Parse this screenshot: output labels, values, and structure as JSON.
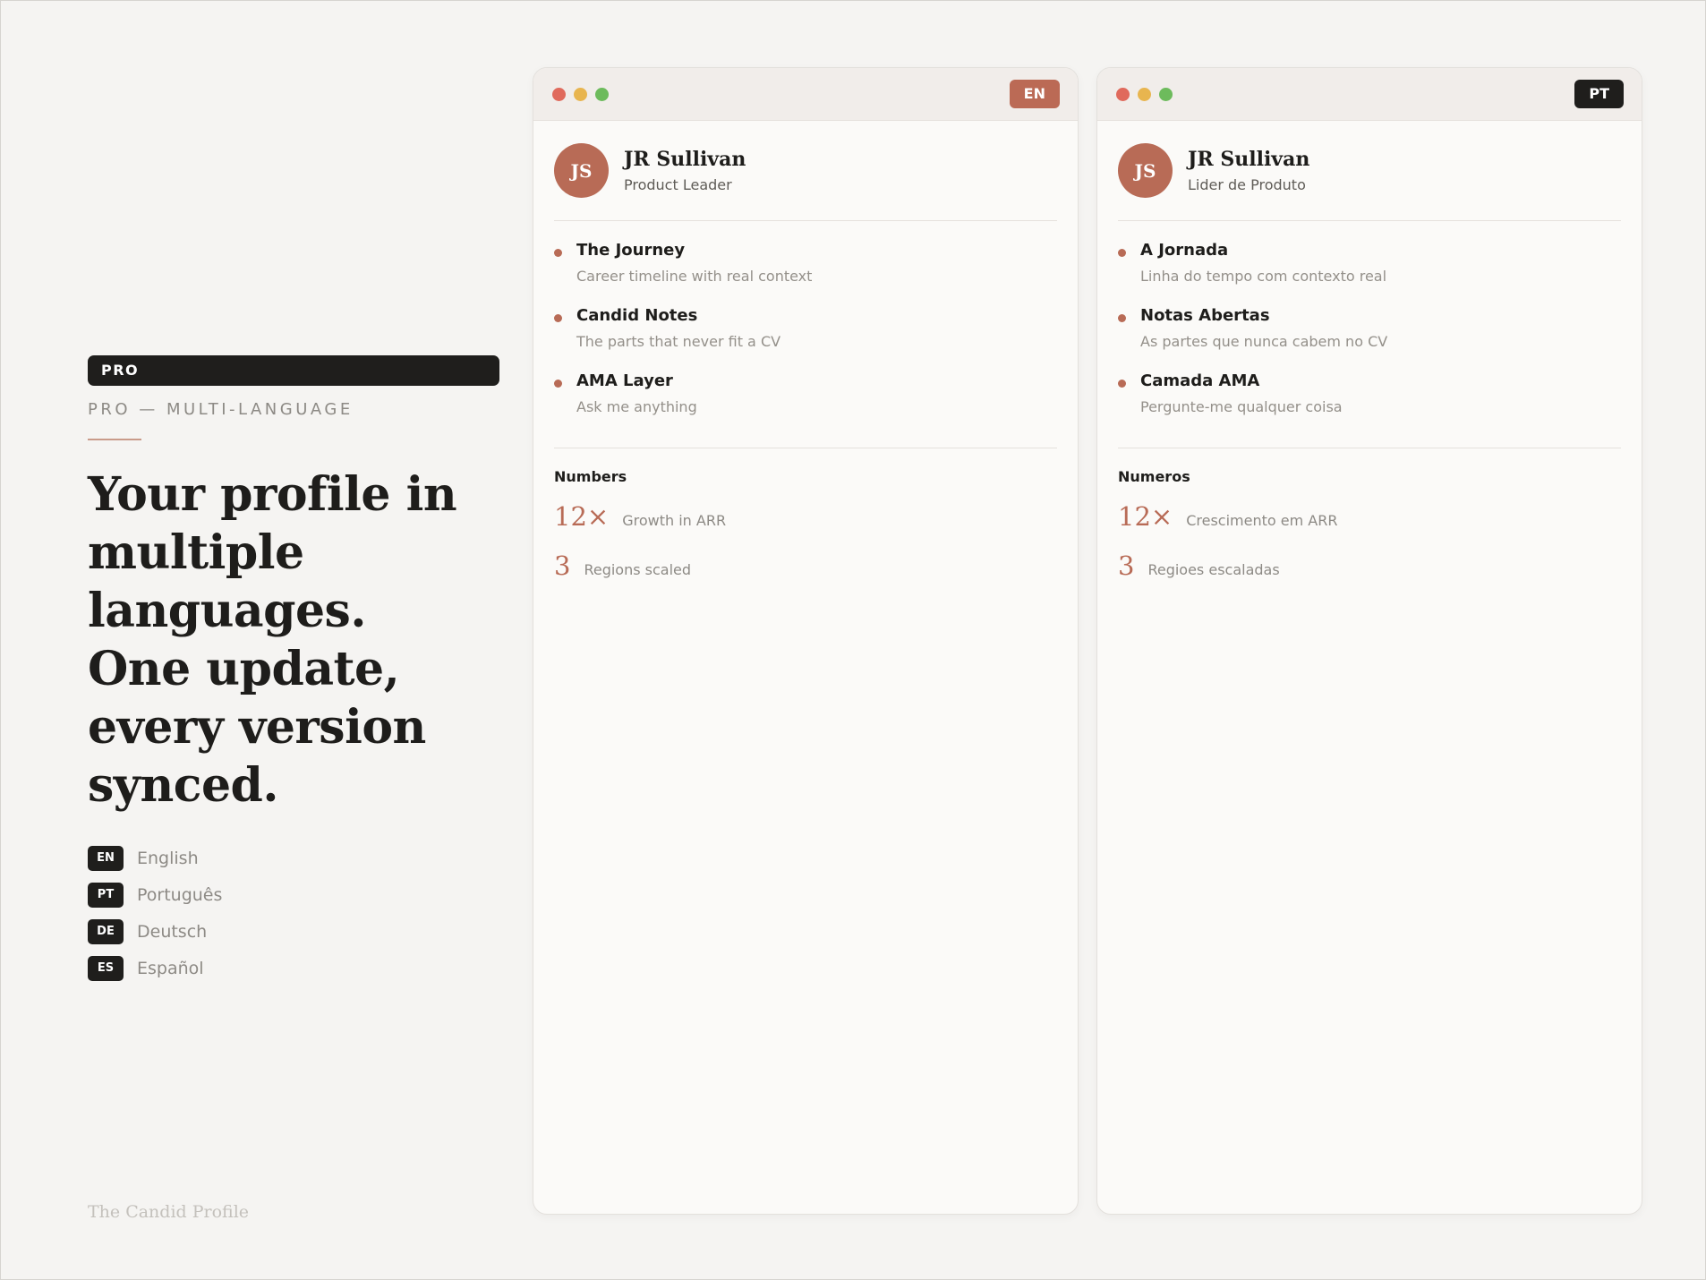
{
  "left": {
    "badge": "PRO",
    "eyebrow": "PRO — MULTI-LANGUAGE",
    "headline": "Your profile in multiple languages. One update, every version synced.",
    "languages": [
      {
        "code": "EN",
        "name": "English"
      },
      {
        "code": "PT",
        "name": "Português"
      },
      {
        "code": "DE",
        "name": "Deutsch"
      },
      {
        "code": "ES",
        "name": "Español"
      }
    ],
    "brand": "The Candid Profile"
  },
  "windows": {
    "en": {
      "tag": "EN",
      "initials": "JS",
      "name": "JR Sullivan",
      "role": "Product Leader",
      "features": [
        {
          "title": "The Journey",
          "subtitle": "Career timeline with real context"
        },
        {
          "title": "Candid Notes",
          "subtitle": "The parts that never fit a CV"
        },
        {
          "title": "AMA Layer",
          "subtitle": "Ask me anything"
        }
      ],
      "numbers_heading": "Numbers",
      "numbers": [
        {
          "value": "12×",
          "label": "Growth in ARR"
        },
        {
          "value": "3",
          "label": "Regions scaled"
        }
      ]
    },
    "pt": {
      "tag": "PT",
      "initials": "JS",
      "name": "JR Sullivan",
      "role": "Lider de Produto",
      "features": [
        {
          "title": "A Jornada",
          "subtitle": "Linha do tempo com contexto real"
        },
        {
          "title": "Notas Abertas",
          "subtitle": "As partes que nunca cabem no CV"
        },
        {
          "title": "Camada AMA",
          "subtitle": "Pergunte-me qualquer coisa"
        }
      ],
      "numbers_heading": "Numeros",
      "numbers": [
        {
          "value": "12×",
          "label": "Crescimento em ARR"
        },
        {
          "value": "3",
          "label": "Regioes escaladas"
        }
      ]
    }
  },
  "colors": {
    "accent": "#b86b56",
    "dark": "#1f1e1c",
    "background": "#f5f4f2"
  }
}
